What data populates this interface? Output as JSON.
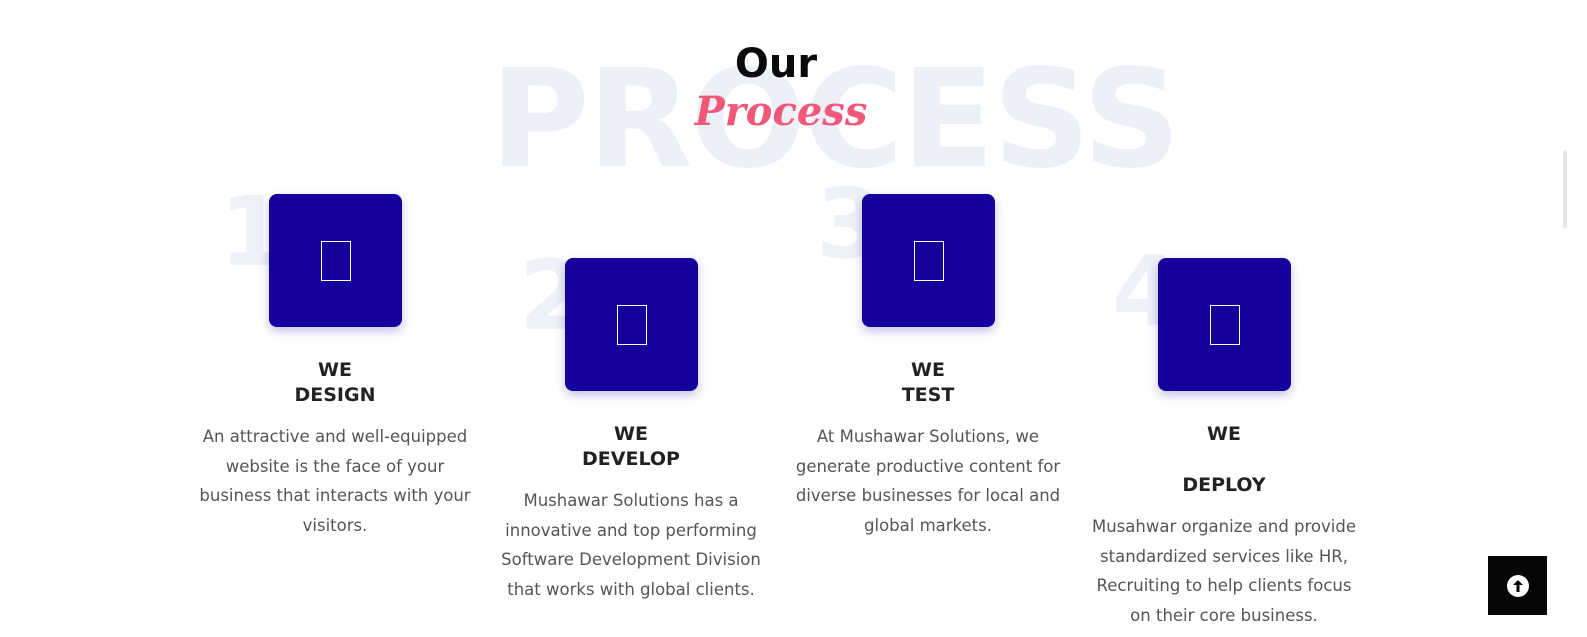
{
  "section": {
    "bg_word": "PROCESS",
    "title_top": "Our",
    "title_accent": "Process"
  },
  "steps": [
    {
      "number": "1",
      "title_line1": "WE",
      "title_line2": "DESIGN",
      "description": "An attractive and well-equipped website is the face of your business that interacts with your visitors.",
      "icon": "design-icon"
    },
    {
      "number": "2",
      "title_line1": "WE",
      "title_line2": "DEVELOP",
      "description": "Mushawar Solutions has a innovative and top performing Software Development Division that works with global clients.",
      "icon": "develop-icon"
    },
    {
      "number": "3",
      "title_line1": "WE",
      "title_line2": "TEST",
      "description": "At Mushawar Solutions, we generate productive content for diverse businesses for local and global markets.",
      "icon": "test-icon"
    },
    {
      "number": "4",
      "title_line1": "WE",
      "title_line2": "DEPLOY",
      "description": "Musahwar organize and provide standardized services like HR, Recruiting to help clients focus on their core business.",
      "icon": "deploy-icon"
    }
  ],
  "colors": {
    "icon_box": "#15009c",
    "accent": "#f0587a",
    "heading": "#222222",
    "text": "#555555"
  },
  "scroll_top": {
    "icon": "arrow-up-circle-icon"
  }
}
